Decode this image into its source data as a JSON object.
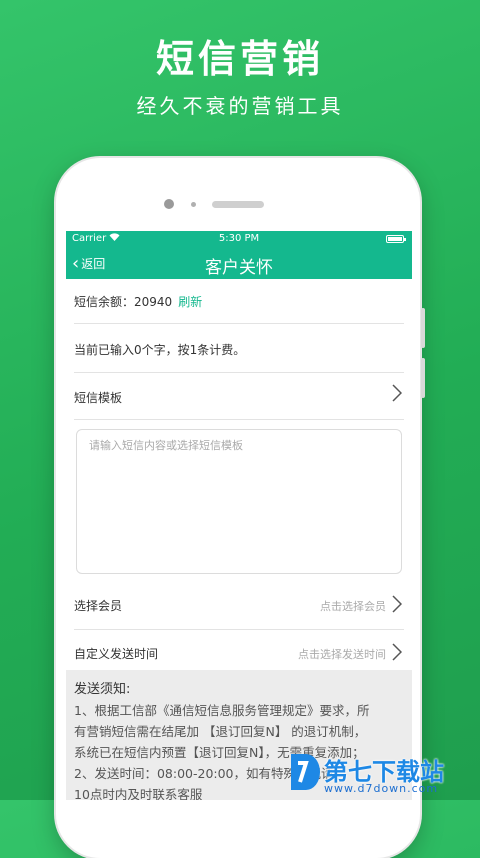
{
  "hero": {
    "title": "短信营销",
    "subtitle": "经久不衰的营销工具"
  },
  "status_bar": {
    "carrier": "Carrier",
    "time": "5:30 PM"
  },
  "nav": {
    "back_label": "返回",
    "title": "客户关怀"
  },
  "balance": {
    "label": "短信余额：20940",
    "refresh_label": "刷新"
  },
  "char_count_text": "当前已输入0个字，按1条计费。",
  "template": {
    "label": "短信模板"
  },
  "message": {
    "placeholder": "请输入短信内容或选择短信模板"
  },
  "member": {
    "label": "选择会员",
    "hint": "点击选择会员"
  },
  "send_time": {
    "label": "自定义发送时间",
    "hint": "点击选择发送时间"
  },
  "notice": {
    "title": "发送须知:",
    "lines": [
      "1、根据工信部《通信短信息服务管理规定》要求，所",
      "有营销短信需在结尾加 【退订回复N】 的退订机制，",
      "系统已在短信内预置【退订回复N】，无需重复添加；",
      "2、发送时间：08:00-20:00，如有特殊情况请",
      "10点时内及时联系客服"
    ]
  },
  "watermark": {
    "title": "第七下载站",
    "url": "www.d7down.com"
  },
  "colors": {
    "background_green": "#22ad55",
    "accent_teal": "#14b88e"
  }
}
